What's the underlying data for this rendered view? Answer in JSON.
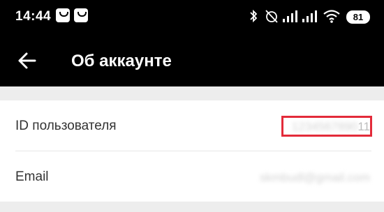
{
  "statusbar": {
    "time": "14:44",
    "battery": "81"
  },
  "toolbar": {
    "title": "Об аккаунте"
  },
  "rows": [
    {
      "label": "ID пользователя",
      "value_hidden": "1234567890",
      "value_suffix": "11"
    },
    {
      "label": "Email",
      "value_hidden": "skmbudl@gmail.com"
    }
  ]
}
